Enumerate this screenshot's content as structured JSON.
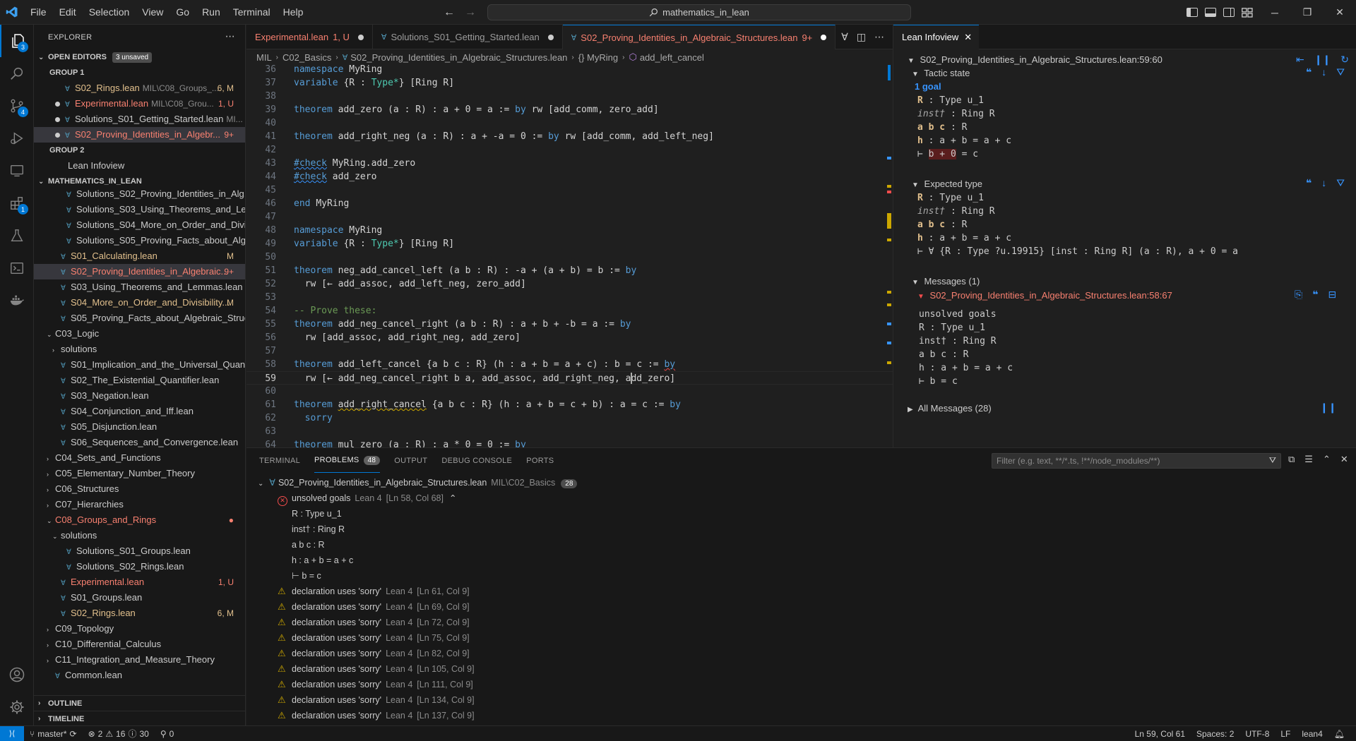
{
  "menu": [
    "File",
    "Edit",
    "Selection",
    "View",
    "Go",
    "Run",
    "Terminal",
    "Help"
  ],
  "search": {
    "text": "mathematics_in_lean"
  },
  "activity_badges": {
    "explorer": "3",
    "scm": "4",
    "extensions": "1"
  },
  "explorer": {
    "title": "EXPLORER",
    "open_editors": "OPEN EDITORS",
    "unsaved": "3 unsaved",
    "group1": "GROUP 1",
    "group2": "GROUP 2",
    "open_g1": [
      {
        "name": "S02_Rings.lean",
        "desc": "MIL\\C08_Groups_...",
        "status": "6, M",
        "cls": "mod"
      },
      {
        "name": "Experimental.lean",
        "desc": "MIL\\C08_Grou...",
        "status": "1, U",
        "cls": "err"
      },
      {
        "name": "Solutions_S01_Getting_Started.lean",
        "desc": "MI...",
        "status": "",
        "cls": ""
      },
      {
        "name": "S02_Proving_Identities_in_Algebr...",
        "desc": "",
        "status": "9+",
        "cls": "err"
      }
    ],
    "open_g2": [
      {
        "name": "Lean Infoview"
      }
    ],
    "root": "MATHEMATICS_IN_LEAN",
    "tree": [
      {
        "name": "Solutions_S02_Proving_Identities_in_Alg...",
        "indent": 3,
        "status": "",
        "cls": ""
      },
      {
        "name": "Solutions_S03_Using_Theorems_and_Le...",
        "indent": 3,
        "status": "",
        "cls": ""
      },
      {
        "name": "Solutions_S04_More_on_Order_and_Divi...",
        "indent": 3,
        "status": "",
        "cls": ""
      },
      {
        "name": "Solutions_S05_Proving_Facts_about_Alg...",
        "indent": 3,
        "status": "",
        "cls": ""
      },
      {
        "name": "S01_Calculating.lean",
        "indent": 2,
        "status": "M",
        "cls": "mod"
      },
      {
        "name": "S02_Proving_Identities_in_Algebraic...",
        "indent": 2,
        "status": "9+",
        "cls": "err",
        "selected": true
      },
      {
        "name": "S03_Using_Theorems_and_Lemmas.lean",
        "indent": 2,
        "status": "",
        "cls": ""
      },
      {
        "name": "S04_More_on_Order_and_Divisibility...",
        "indent": 2,
        "status": "M",
        "cls": "mod"
      },
      {
        "name": "S05_Proving_Facts_about_Algebraic_Struc...",
        "indent": 2,
        "status": "",
        "cls": ""
      },
      {
        "name": "C03_Logic",
        "indent": 1,
        "status": "",
        "cls": "",
        "folder": "open"
      },
      {
        "name": "solutions",
        "indent": 2,
        "status": "",
        "cls": "",
        "folder": "closed"
      },
      {
        "name": "S01_Implication_and_the_Universal_Quan...",
        "indent": 2,
        "status": "",
        "cls": ""
      },
      {
        "name": "S02_The_Existential_Quantifier.lean",
        "indent": 2,
        "status": "",
        "cls": ""
      },
      {
        "name": "S03_Negation.lean",
        "indent": 2,
        "status": "",
        "cls": ""
      },
      {
        "name": "S04_Conjunction_and_Iff.lean",
        "indent": 2,
        "status": "",
        "cls": ""
      },
      {
        "name": "S05_Disjunction.lean",
        "indent": 2,
        "status": "",
        "cls": ""
      },
      {
        "name": "S06_Sequences_and_Convergence.lean",
        "indent": 2,
        "status": "",
        "cls": ""
      },
      {
        "name": "C04_Sets_and_Functions",
        "indent": 1,
        "status": "",
        "cls": "",
        "folder": "closed"
      },
      {
        "name": "C05_Elementary_Number_Theory",
        "indent": 1,
        "status": "",
        "cls": "",
        "folder": "closed"
      },
      {
        "name": "C06_Structures",
        "indent": 1,
        "status": "",
        "cls": "",
        "folder": "closed"
      },
      {
        "name": "C07_Hierarchies",
        "indent": 1,
        "status": "",
        "cls": "",
        "folder": "closed"
      },
      {
        "name": "C08_Groups_and_Rings",
        "indent": 1,
        "status": "●",
        "cls": "err",
        "folder": "open"
      },
      {
        "name": "solutions",
        "indent": 2,
        "status": "",
        "cls": "",
        "folder": "open"
      },
      {
        "name": "Solutions_S01_Groups.lean",
        "indent": 3,
        "status": "",
        "cls": ""
      },
      {
        "name": "Solutions_S02_Rings.lean",
        "indent": 3,
        "status": "",
        "cls": ""
      },
      {
        "name": "Experimental.lean",
        "indent": 2,
        "status": "1, U",
        "cls": "err"
      },
      {
        "name": "S01_Groups.lean",
        "indent": 2,
        "status": "",
        "cls": ""
      },
      {
        "name": "S02_Rings.lean",
        "indent": 2,
        "status": "6, M",
        "cls": "mod"
      },
      {
        "name": "C09_Topology",
        "indent": 1,
        "status": "",
        "cls": "",
        "folder": "closed"
      },
      {
        "name": "C10_Differential_Calculus",
        "indent": 1,
        "status": "",
        "cls": "",
        "folder": "closed"
      },
      {
        "name": "C11_Integration_and_Measure_Theory",
        "indent": 1,
        "status": "",
        "cls": "",
        "folder": "closed"
      },
      {
        "name": "Common.lean",
        "indent": 1,
        "status": "",
        "cls": ""
      }
    ],
    "outline": "OUTLINE",
    "timeline": "TIMELINE"
  },
  "tabs": [
    {
      "label": "Experimental.lean",
      "suffix": "1, U",
      "cls": "err",
      "active": false
    },
    {
      "label": "Solutions_S01_Getting_Started.lean",
      "suffix": "",
      "cls": "",
      "active": false
    },
    {
      "label": "S02_Proving_Identities_in_Algebraic_Structures.lean",
      "suffix": "9+",
      "cls": "err",
      "active": true
    }
  ],
  "breadcrumbs": [
    "MIL",
    "C02_Basics",
    "S02_Proving_Identities_in_Algebraic_Structures.lean",
    "{} MyRing",
    "add_left_cancel"
  ],
  "code": [
    {
      "n": 36,
      "t": "namespace MyRing"
    },
    {
      "n": 37,
      "t": "variable {R : Type*} [Ring R]"
    },
    {
      "n": 38,
      "t": ""
    },
    {
      "n": 39,
      "t": "theorem add_zero (a : R) : a + 0 = a := by rw [add_comm, zero_add]"
    },
    {
      "n": 40,
      "t": ""
    },
    {
      "n": 41,
      "t": "theorem add_right_neg (a : R) : a + -a = 0 := by rw [add_comm, add_left_neg]"
    },
    {
      "n": 42,
      "t": ""
    },
    {
      "n": 43,
      "t": "#check MyRing.add_zero"
    },
    {
      "n": 44,
      "t": "#check add_zero"
    },
    {
      "n": 45,
      "t": ""
    },
    {
      "n": 46,
      "t": "end MyRing"
    },
    {
      "n": 47,
      "t": ""
    },
    {
      "n": 48,
      "t": "namespace MyRing"
    },
    {
      "n": 49,
      "t": "variable {R : Type*} [Ring R]"
    },
    {
      "n": 50,
      "t": ""
    },
    {
      "n": 51,
      "t": "theorem neg_add_cancel_left (a b : R) : -a + (a + b) = b := by"
    },
    {
      "n": 52,
      "t": "  rw [← add_assoc, add_left_neg, zero_add]"
    },
    {
      "n": 53,
      "t": ""
    },
    {
      "n": 54,
      "t": "-- Prove these:"
    },
    {
      "n": 55,
      "t": "theorem add_neg_cancel_right (a b : R) : a + b + -b = a := by"
    },
    {
      "n": 56,
      "t": "  rw [add_assoc, add_right_neg, add_zero]"
    },
    {
      "n": 57,
      "t": ""
    },
    {
      "n": 58,
      "t": "theorem add_left_cancel {a b c : R} (h : a + b = a + c) : b = c := by"
    },
    {
      "n": 59,
      "t": "  rw [← add_neg_cancel_right b a, add_assoc, add_right_neg, add_zero]"
    },
    {
      "n": 60,
      "t": ""
    },
    {
      "n": 61,
      "t": "theorem add_right_cancel {a b c : R} (h : a + b = c + b) : a = c := by"
    },
    {
      "n": 62,
      "t": "  sorry"
    },
    {
      "n": 63,
      "t": ""
    },
    {
      "n": 64,
      "t": "theorem mul_zero (a : R) : a * 0 = 0 := by"
    }
  ],
  "infoview": {
    "tab": "Lean Infoview",
    "location": "S02_Proving_Identities_in_Algebraic_Structures.lean:59:60",
    "tactic_state": "Tactic state",
    "goal_count": "1 goal",
    "tactic": {
      "h1_name": "R",
      "h1_type": " : Type u_1",
      "h2_name": "inst†",
      "h2_type": " : Ring R",
      "h3_name": "a b c",
      "h3_type": " : R",
      "h4_name": "h",
      "h4_type": " : a + b = a + c",
      "goal_turnstile": "⊢ ",
      "goal_hl": "b + 0",
      "goal_rest": " = c"
    },
    "expected_type": "Expected type",
    "expected": {
      "h1_name": "R",
      "h1_type": " : Type u_1",
      "h2_name": "inst†",
      "h2_type": " : Ring R",
      "h3_name": "a b c",
      "h3_type": " : R",
      "h4_name": "h",
      "h4_type": " : a + b = a + c",
      "goal": "⊢ ∀ {R : Type ?u.19915} [inst : Ring R] (a : R), a + 0 = a"
    },
    "messages": "Messages (1)",
    "msg_location": "S02_Proving_Identities_in_Algebraic_Structures.lean:58:67",
    "msg_lines": [
      "unsolved goals",
      "R : Type u_1",
      "inst† : Ring R",
      "a b c : R",
      "h : a + b = a + c",
      "⊢ b = c"
    ],
    "all_messages": "All Messages (28)"
  },
  "panel": {
    "tabs": [
      "TERMINAL",
      "PROBLEMS",
      "OUTPUT",
      "DEBUG CONSOLE",
      "PORTS"
    ],
    "problems_count": "48",
    "filter_placeholder": "Filter (e.g. text, **/*.ts, !**/node_modules/**)",
    "file": "S02_Proving_Identities_in_Algebraic_Structures.lean",
    "file_path": "MIL\\C02_Basics",
    "file_count": "28",
    "error_title": "unsolved goals",
    "error_src": "Lean 4",
    "error_loc": "[Ln 58, Col 68]",
    "error_detail": [
      "R : Type u_1",
      "inst† : Ring R",
      "a b c : R",
      "h : a + b = a + c",
      "⊢ b = c"
    ],
    "warnings": [
      {
        "msg": "declaration uses 'sorry'",
        "src": "Lean 4",
        "loc": "[Ln 61, Col 9]"
      },
      {
        "msg": "declaration uses 'sorry'",
        "src": "Lean 4",
        "loc": "[Ln 69, Col 9]"
      },
      {
        "msg": "declaration uses 'sorry'",
        "src": "Lean 4",
        "loc": "[Ln 72, Col 9]"
      },
      {
        "msg": "declaration uses 'sorry'",
        "src": "Lean 4",
        "loc": "[Ln 75, Col 9]"
      },
      {
        "msg": "declaration uses 'sorry'",
        "src": "Lean 4",
        "loc": "[Ln 82, Col 9]"
      },
      {
        "msg": "declaration uses 'sorry'",
        "src": "Lean 4",
        "loc": "[Ln 105, Col 9]"
      },
      {
        "msg": "declaration uses 'sorry'",
        "src": "Lean 4",
        "loc": "[Ln 111, Col 9]"
      },
      {
        "msg": "declaration uses 'sorry'",
        "src": "Lean 4",
        "loc": "[Ln 134, Col 9]"
      },
      {
        "msg": "declaration uses 'sorry'",
        "src": "Lean 4",
        "loc": "[Ln 137, Col 9]"
      }
    ]
  },
  "status": {
    "branch": "master*",
    "errors": "2",
    "warnings": "16",
    "infos": "30",
    "ports": "0",
    "position": "Ln 59, Col 61",
    "spaces": "Spaces: 2",
    "encoding": "UTF-8",
    "eol": "LF",
    "language": "lean4"
  }
}
